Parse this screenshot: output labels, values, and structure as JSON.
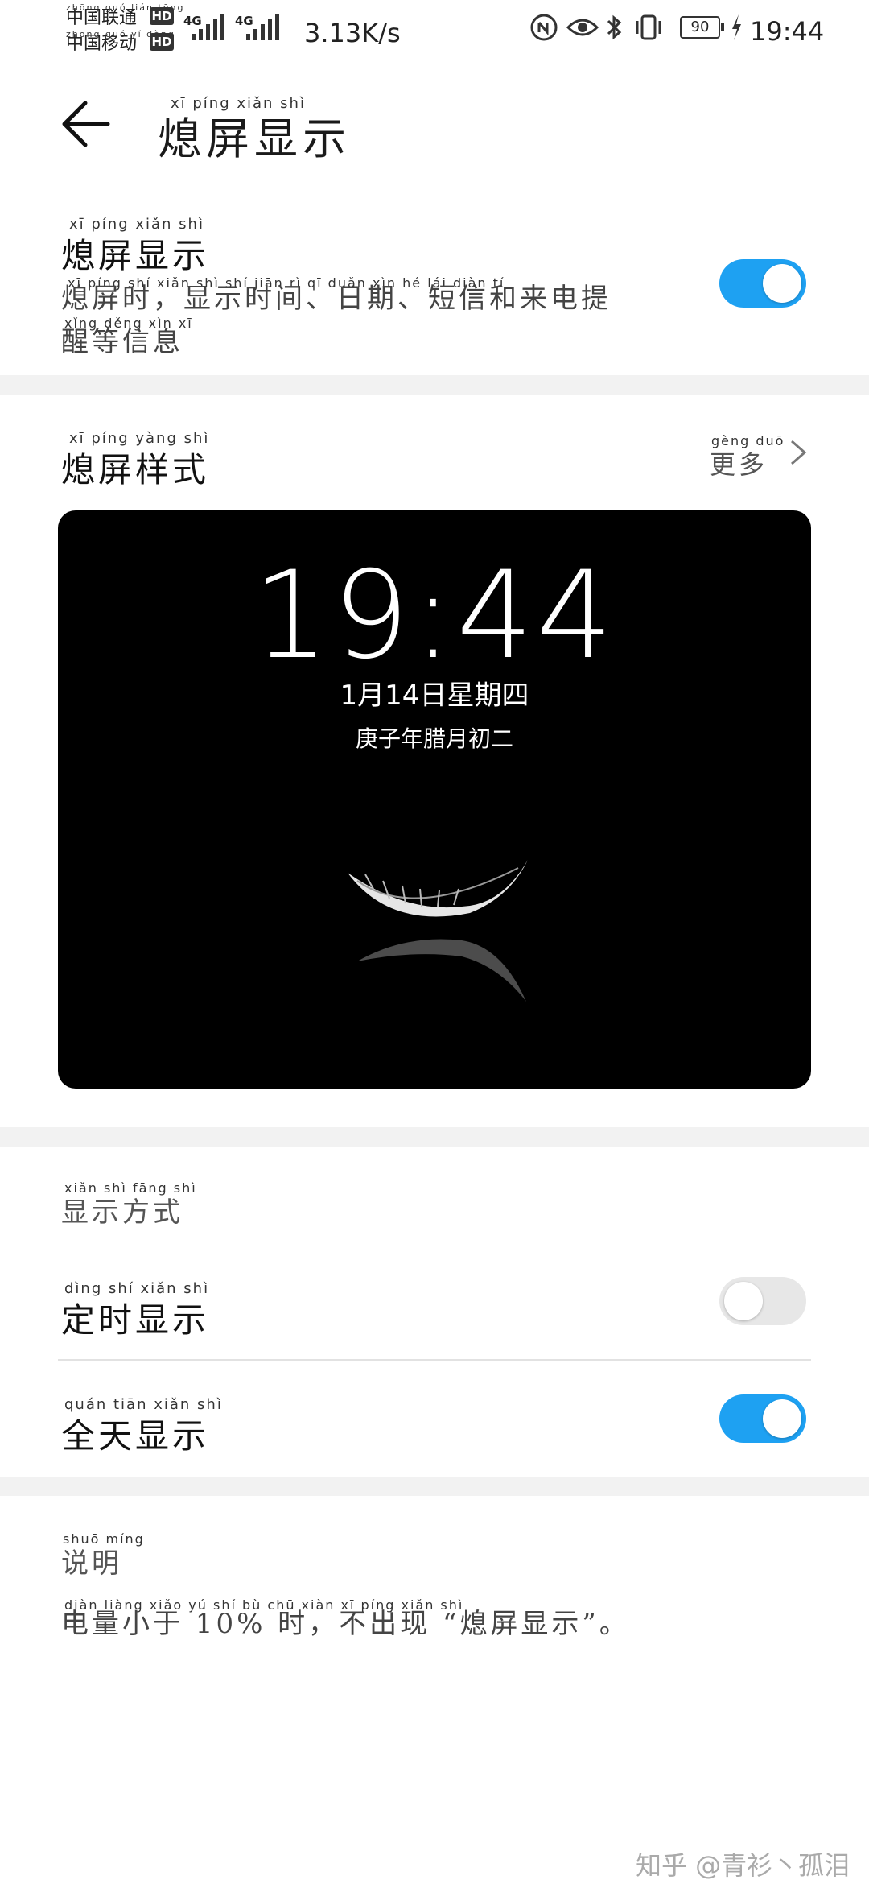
{
  "status_bar": {
    "carrier1": "中国联通",
    "carrier2": "中国移动",
    "carrier1_pinyin": "zhōng guó lián tōng",
    "carrier2_pinyin": "zhōng guó yí dòng",
    "hd": "HD",
    "net1": "4G",
    "net2": "4G",
    "speed": "3.13K/s",
    "battery": "90",
    "time": "19:44",
    "icons": [
      "nfc-icon",
      "eye-comfort-icon",
      "bluetooth-icon",
      "vibrate-icon",
      "battery-icon",
      "charging-icon"
    ]
  },
  "header": {
    "title": "熄屏显示",
    "title_pinyin": "xī   píng  xiǎn  shì"
  },
  "aod_toggle": {
    "title": "熄屏显示",
    "title_pinyin": "xī  píng  xiǎn  shì",
    "desc_line1": "熄屏时，显示时间、日期、短信和来电提",
    "desc_line2": "醒等信息",
    "desc_pinyin1": "xī  píng  shí     xiǎn  shì  shí  jiān     rì   qī     duǎn  xìn  hé  lái  diàn  tí",
    "desc_pinyin2": "xǐng  děng  xìn  xī",
    "state": "on"
  },
  "style_section": {
    "title": "熄屏样式",
    "title_pinyin": "xī  píng  yàng  shì",
    "more_label": "更多",
    "more_pinyin": "gèng  duō"
  },
  "preview": {
    "time": "19:44",
    "date": "1月14日星期四",
    "lunar": "庚子年腊月初二"
  },
  "display_mode": {
    "caption": "显示方式",
    "caption_pinyin": "xiǎn  shì  fāng  shì",
    "scheduled": {
      "label": "定时显示",
      "pinyin": "dìng  shí  xiǎn  shì",
      "state": "off"
    },
    "all_day": {
      "label": "全天显示",
      "pinyin": "quán  tiān  xiǎn  shì",
      "state": "on"
    }
  },
  "notes": {
    "caption": "说明",
    "caption_pinyin": "shuō  míng",
    "text": "电量小于 10% 时，不出现 “熄屏显示”。",
    "text_pinyin": "diàn  liàng  xiǎo  yú           shí     bù  chū  xiàn     xī  píng  xiǎn  shì"
  },
  "watermark": "知乎 @青衫丶孤泪",
  "colors": {
    "toggle_on": "#1ea1f2",
    "toggle_off": "#e7e7e7",
    "section_divider": "#f2f2f2"
  }
}
